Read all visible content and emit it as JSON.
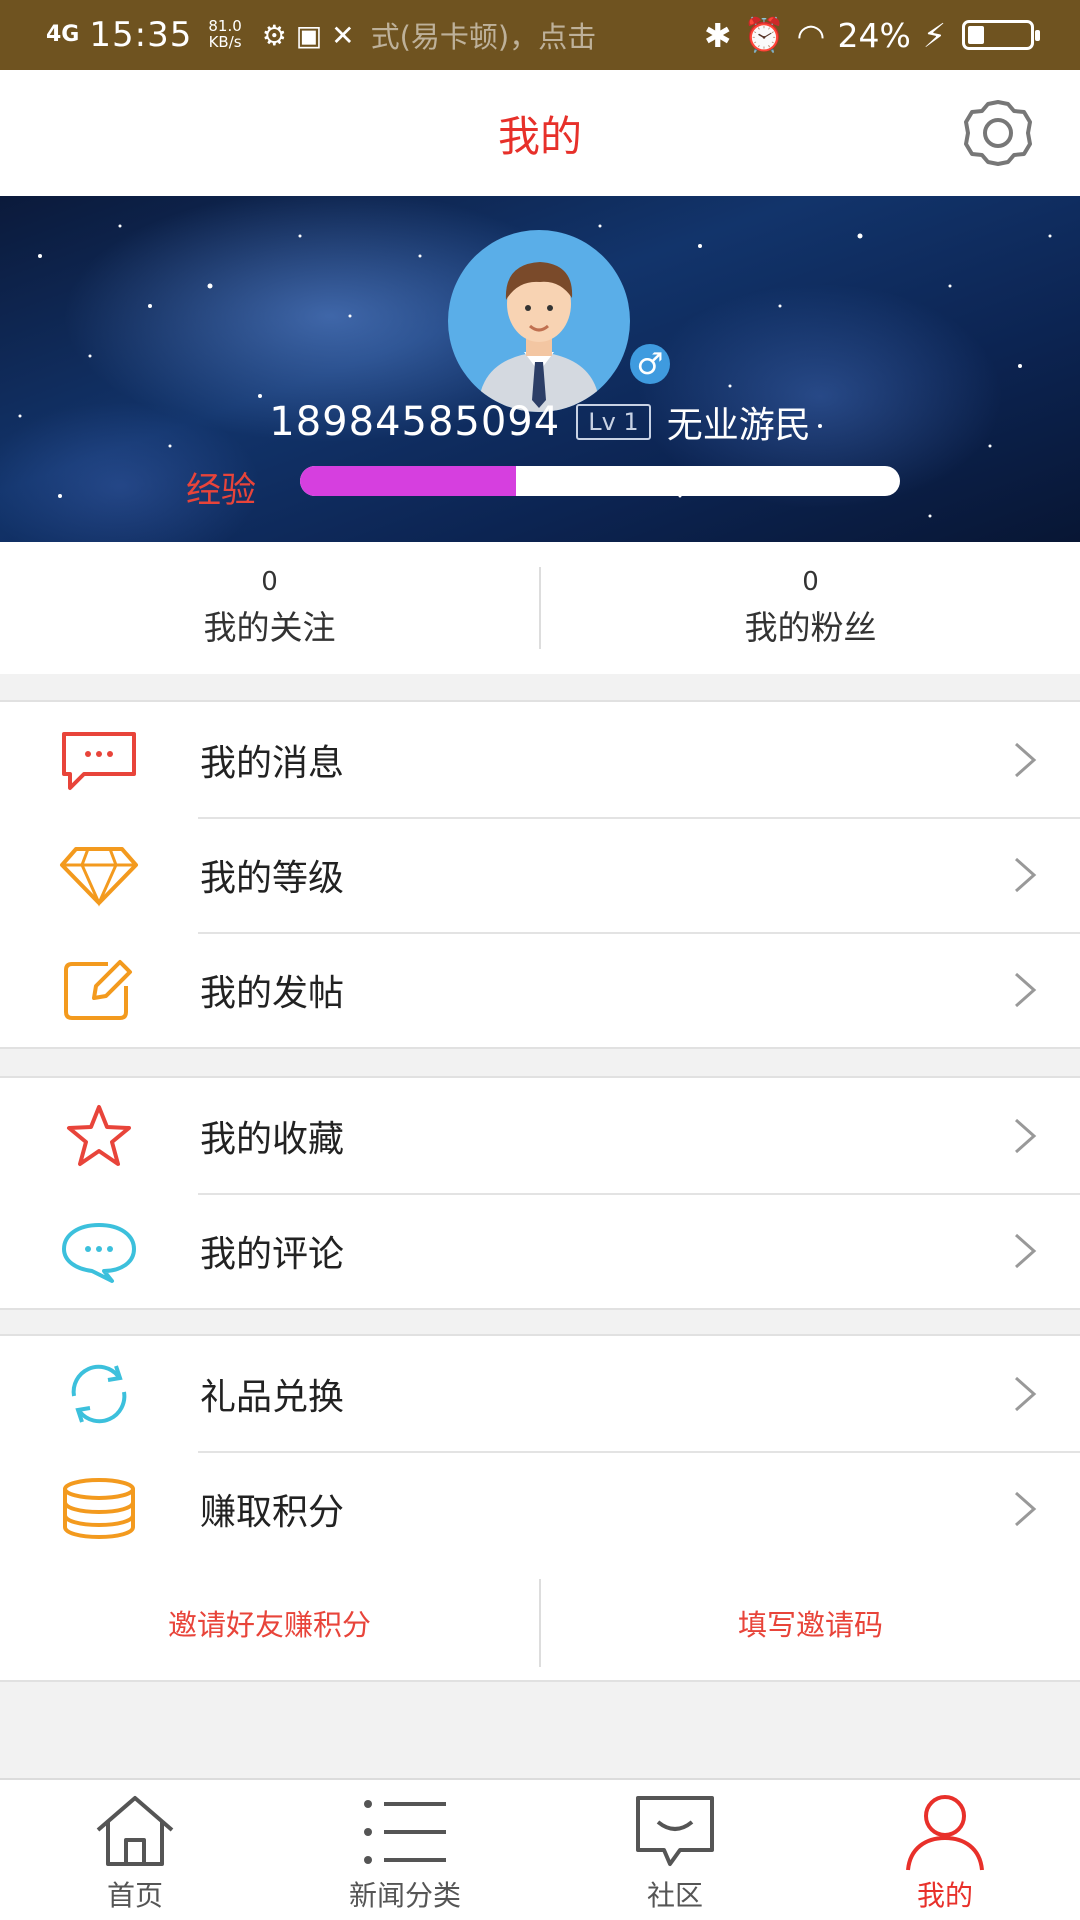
{
  "status_bar": {
    "signal": "4G",
    "time": "15:35",
    "speed_value": "81.0",
    "speed_unit": "KB/s",
    "notice": "式(易卡顿)，点击",
    "battery": "24%"
  },
  "header": {
    "title": "我的",
    "settings_icon": "gear-icon"
  },
  "profile": {
    "phone": "18984585094",
    "level": "Lv 1",
    "title": "无业游民",
    "gender": "♂",
    "exp_label": "经验",
    "exp_progress": 0.36
  },
  "stats": [
    {
      "count": "0",
      "label": "我的关注"
    },
    {
      "count": "0",
      "label": "我的粉丝"
    }
  ],
  "menu_groups": [
    [
      {
        "label": "我的消息",
        "icon": "message-icon"
      },
      {
        "label": "我的等级",
        "icon": "diamond-icon"
      },
      {
        "label": "我的发帖",
        "icon": "edit-icon"
      }
    ],
    [
      {
        "label": "我的收藏",
        "icon": "star-icon"
      },
      {
        "label": "我的评论",
        "icon": "comment-icon"
      }
    ],
    [
      {
        "label": "礼品兑换",
        "icon": "exchange-icon"
      },
      {
        "label": "赚取积分",
        "icon": "coins-icon"
      }
    ]
  ],
  "invite": {
    "invite_friends": "邀请好友赚积分",
    "fill_code": "填写邀请码"
  },
  "bottom_nav": [
    {
      "label": "首页",
      "icon": "home-icon"
    },
    {
      "label": "新闻分类",
      "icon": "list-icon"
    },
    {
      "label": "社区",
      "icon": "chat-icon"
    },
    {
      "label": "我的",
      "icon": "user-icon",
      "active": true
    }
  ],
  "colors": {
    "accent": "#e7302a",
    "status_bar": "#6f5320",
    "exp_fill": "#d63fdf"
  }
}
